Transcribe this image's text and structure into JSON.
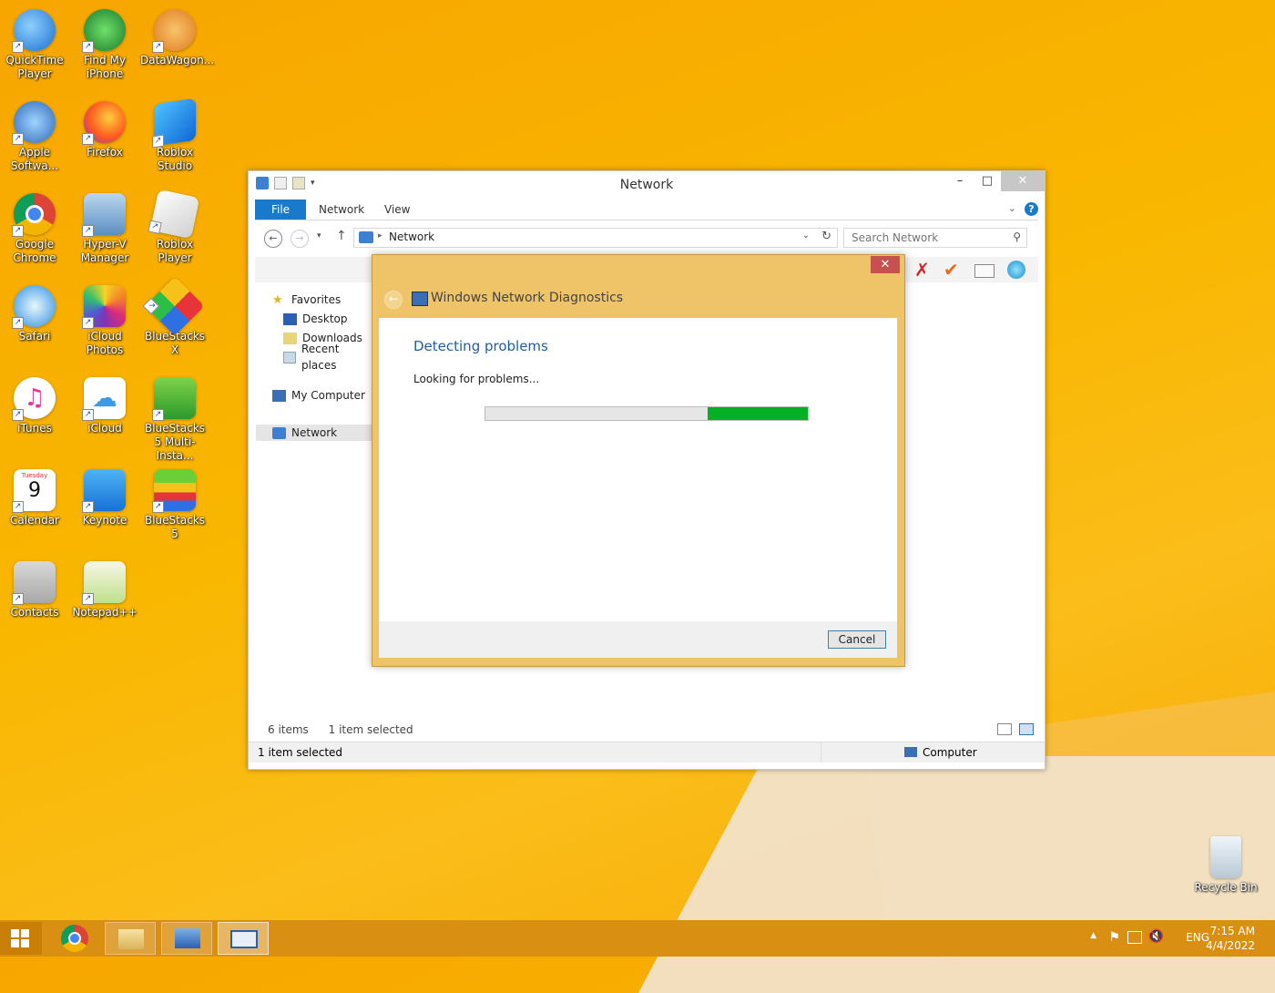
{
  "desktop": {
    "icons": [
      {
        "label": "QuickTime Player"
      },
      {
        "label": "Find My iPhone"
      },
      {
        "label": "DataWagon..."
      },
      {
        "label": "Apple Softwa..."
      },
      {
        "label": "Firefox"
      },
      {
        "label": "Roblox Studio"
      },
      {
        "label": "Google Chrome"
      },
      {
        "label": "Hyper-V Manager"
      },
      {
        "label": "Roblox Player"
      },
      {
        "label": "Safari"
      },
      {
        "label": "iCloud Photos"
      },
      {
        "label": "BlueStacks X"
      },
      {
        "label": "iTunes"
      },
      {
        "label": "iCloud"
      },
      {
        "label": "BlueStacks 5 Multi-Insta..."
      },
      {
        "label": "Calendar"
      },
      {
        "label": "Keynote"
      },
      {
        "label": "BlueStacks 5"
      },
      {
        "label": "Contacts"
      },
      {
        "label": "Notepad++"
      },
      {
        "label": "Recycle Bin"
      }
    ],
    "calendar_icon": {
      "day": "Tuesday",
      "date": "9"
    }
  },
  "explorer": {
    "title": "Network",
    "tabs": {
      "file": "File",
      "network": "Network",
      "view": "View"
    },
    "address": "Network",
    "search_placeholder": "Search Network",
    "nav": {
      "favorites": "Favorites",
      "desktop": "Desktop",
      "downloads": "Downloads",
      "recent": "Recent places",
      "computer": "My Computer",
      "network": "Network"
    },
    "status": {
      "items": "6 items",
      "selected": "1 item selected",
      "bottom_left": "1 item selected",
      "bottom_right": "Computer"
    }
  },
  "dialog": {
    "title": "Windows Network Diagnostics",
    "heading": "Detecting problems",
    "subtext": "Looking for problems...",
    "progress": 0.69,
    "cancel": "Cancel"
  },
  "taskbar": {
    "lang": "ENG",
    "time": "7:15 AM",
    "date": "4/4/2022"
  },
  "colors": {
    "accent": "#1979ca",
    "dialog_frame": "#efc469",
    "progress": "#06b025",
    "taskbar": "#d98f12"
  }
}
